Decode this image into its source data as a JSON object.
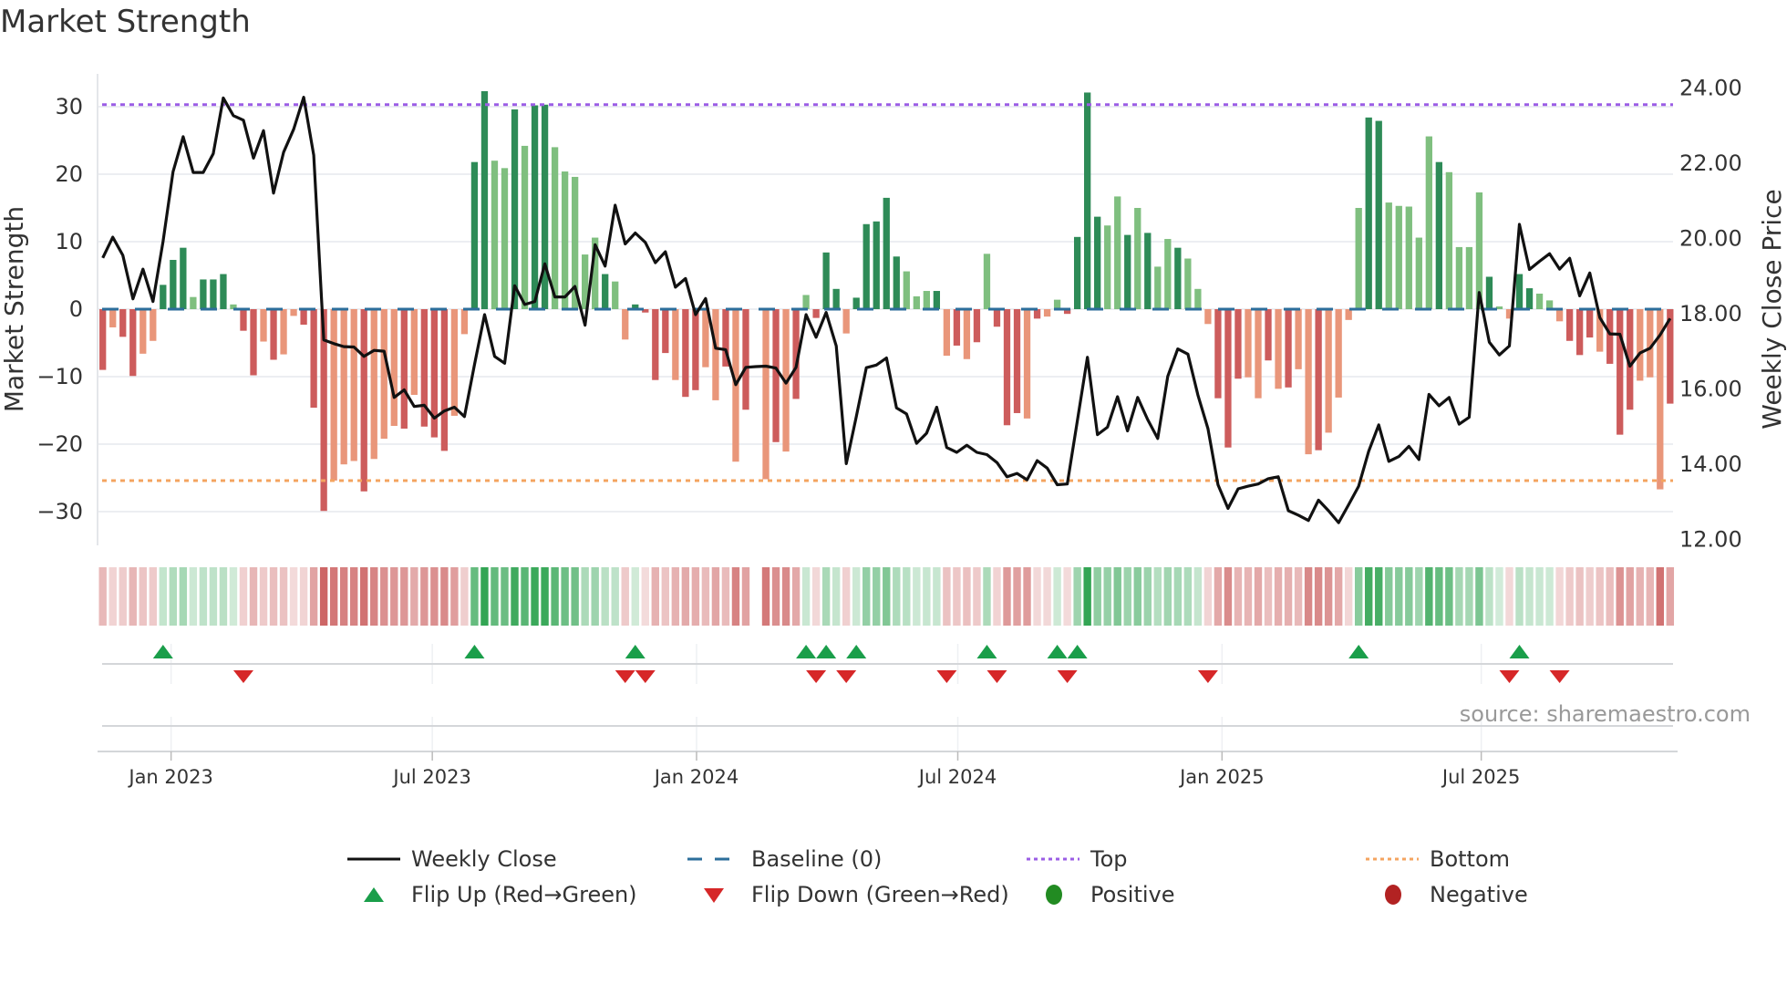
{
  "title": "Market Strength",
  "source": "source: sharemaestro.com",
  "chart_data": {
    "type": "bar",
    "title": "Market Strength",
    "ylabel": "Market Strength",
    "y2label": "Weekly Close Price",
    "ylim": [
      -35,
      35
    ],
    "y2lim": [
      12,
      24
    ],
    "yticks": [
      -30,
      -20,
      -10,
      0,
      10,
      20,
      30
    ],
    "ytick_labels": [
      "−30",
      "−20",
      "−10",
      "0",
      "10",
      "20",
      "30"
    ],
    "y2ticks": [
      12,
      14,
      16,
      18,
      20,
      22,
      24
    ],
    "y2tick_labels": [
      "12.00",
      "14.00",
      "16.00",
      "18.00",
      "20.00",
      "22.00",
      "24.00"
    ],
    "xticks": [
      {
        "label": "Jan 2023",
        "week": 6.8
      },
      {
        "label": "Jul 2023",
        "week": 32.8
      },
      {
        "label": "Jan 2024",
        "week": 59.1
      },
      {
        "label": "Jul 2024",
        "week": 85.1
      },
      {
        "label": "Jan 2025",
        "week": 111.4
      },
      {
        "label": "Jul 2025",
        "week": 137.2
      }
    ],
    "top_level": 30.3,
    "bottom_level": -25.4,
    "baseline": 0,
    "strength": [
      -9.0,
      -2.7,
      -4.1,
      -9.9,
      -6.6,
      -4.7,
      3.6,
      7.3,
      9.1,
      1.8,
      4.4,
      4.4,
      5.2,
      0.7,
      -3.2,
      -9.8,
      -4.8,
      -7.5,
      -6.7,
      -1.0,
      -2.3,
      -14.6,
      -29.9,
      -25.4,
      -23.0,
      -22.5,
      -27.0,
      -22.2,
      -19.2,
      -17.3,
      -17.7,
      -12.7,
      -17.4,
      -19.0,
      -21.0,
      -15.8,
      -3.7,
      21.8,
      32.3,
      22.0,
      20.9,
      29.6,
      24.2,
      30.2,
      30.3,
      24.0,
      20.4,
      19.6,
      8.1,
      10.6,
      5.2,
      4.1,
      -4.5,
      0.7,
      -0.5,
      -10.5,
      -6.5,
      -10.5,
      -13.0,
      -12.0,
      -8.6,
      -13.5,
      -8.5,
      -22.6,
      -14.9,
      null,
      -25.2,
      -19.7,
      -21.1,
      -13.3,
      2.1,
      -1.3,
      8.4,
      3.0,
      -3.6,
      1.7,
      12.6,
      13.0,
      16.5,
      7.8,
      5.6,
      1.9,
      2.7,
      2.7,
      -6.9,
      -5.4,
      -7.4,
      -4.9,
      8.2,
      -2.6,
      -17.2,
      -15.4,
      -16.2,
      -1.4,
      -1.1,
      1.4,
      -0.7,
      10.7,
      32.1,
      13.7,
      12.4,
      16.7,
      11.0,
      15.0,
      11.3,
      6.3,
      10.4,
      9.1,
      7.5,
      3.0,
      -2.2,
      -13.2,
      -20.5,
      -10.3,
      -10.1,
      -13.2,
      -7.6,
      -11.8,
      -11.6,
      -8.9,
      -21.5,
      -20.9,
      -18.3,
      -13.1,
      -1.6,
      15.0,
      28.4,
      27.9,
      15.8,
      15.3,
      15.2,
      10.6,
      25.6,
      21.8,
      20.3,
      9.2,
      9.2,
      17.3,
      4.8,
      0.4,
      -1.4,
      5.2,
      3.1,
      2.3,
      1.3,
      -1.8,
      -4.7,
      -6.8,
      -4.2,
      -6.3,
      -8.1,
      -18.6,
      -14.9,
      -10.6,
      -10.1,
      -26.7,
      -14.0
    ],
    "shade": "dlddlldddldddlddldlldddllldllldldddllddlldlddllllldllddddlddlldldl-dldldddldddddllldldldldddldllddddlldldlldllldddlldldlldllllddllllldlllldllddllldddldddllldl",
    "weekly_close": [
      19.48,
      20.03,
      19.55,
      18.39,
      19.18,
      18.32,
      19.91,
      21.77,
      22.7,
      21.75,
      21.75,
      22.25,
      23.73,
      23.26,
      23.14,
      22.13,
      22.86,
      21.2,
      22.29,
      22.9,
      23.75,
      22.21,
      17.3,
      17.2,
      17.12,
      17.11,
      16.86,
      17.02,
      17.0,
      15.77,
      15.97,
      15.53,
      15.56,
      15.22,
      15.41,
      15.51,
      15.26,
      16.64,
      17.97,
      16.86,
      16.68,
      18.74,
      18.24,
      18.32,
      19.32,
      18.44,
      18.44,
      18.72,
      17.69,
      19.83,
      19.26,
      20.88,
      19.85,
      20.14,
      19.89,
      19.35,
      19.64,
      18.7,
      18.93,
      17.97,
      18.4,
      17.08,
      17.04,
      16.11,
      16.57,
      16.59,
      16.6,
      16.55,
      16.15,
      16.57,
      17.97,
      17.37,
      18.03,
      17.14,
      14.01,
      15.26,
      16.56,
      16.63,
      16.82,
      15.49,
      15.33,
      14.55,
      14.82,
      15.51,
      14.44,
      14.31,
      14.5,
      14.31,
      14.25,
      14.04,
      13.66,
      13.75,
      13.58,
      14.09,
      13.89,
      13.45,
      13.47,
      15.14,
      16.84,
      14.78,
      14.98,
      15.79,
      14.88,
      15.77,
      15.18,
      14.68,
      16.33,
      17.06,
      16.92,
      15.83,
      14.94,
      13.45,
      12.82,
      13.34,
      13.41,
      13.47,
      13.61,
      13.66,
      12.76,
      12.64,
      12.5,
      13.04,
      12.76,
      12.44,
      12.92,
      13.41,
      14.34,
      15.04,
      14.07,
      14.2,
      14.47,
      14.12,
      15.85,
      15.55,
      15.77,
      15.06,
      15.24,
      18.56,
      17.24,
      16.9,
      17.14,
      20.37,
      19.17,
      19.39,
      19.59,
      19.18,
      19.47,
      18.47,
      19.08,
      17.89,
      17.46,
      17.45,
      16.6,
      16.95,
      17.08,
      17.43,
      17.87
    ],
    "flip_up_weeks": [
      7,
      38,
      54,
      71,
      73,
      76,
      89,
      96,
      98,
      126,
      142
    ],
    "flip_down_weeks": [
      15,
      53,
      55,
      72,
      75,
      85,
      90,
      97,
      111,
      141,
      146
    ],
    "colors": {
      "pos_dark": "#2e8b57",
      "pos_light": "#7fbf7f",
      "neg_dark": "#cd5c5c",
      "neg_light": "#e9967a",
      "line": "#111111",
      "baseline": "#2c6e9b",
      "top": "#9b5de5",
      "bottom": "#f4a460",
      "flip_up": "#1a9e4a",
      "flip_down": "#d62728",
      "positive": "#228b22",
      "negative": "#b22222"
    },
    "legend": {
      "placement": "bottom",
      "items": [
        {
          "label": "Weekly Close",
          "symbol": "line"
        },
        {
          "label": "Baseline (0)",
          "symbol": "dash"
        },
        {
          "label": "Top",
          "symbol": "dot-purple"
        },
        {
          "label": "Bottom",
          "symbol": "dot-orange"
        },
        {
          "label": "Flip Up (Red→Green)",
          "symbol": "triangle-up"
        },
        {
          "label": "Flip Down (Green→Red)",
          "symbol": "triangle-down"
        },
        {
          "label": "Positive",
          "symbol": "circle-green"
        },
        {
          "label": "Negative",
          "symbol": "circle-red"
        }
      ]
    }
  }
}
